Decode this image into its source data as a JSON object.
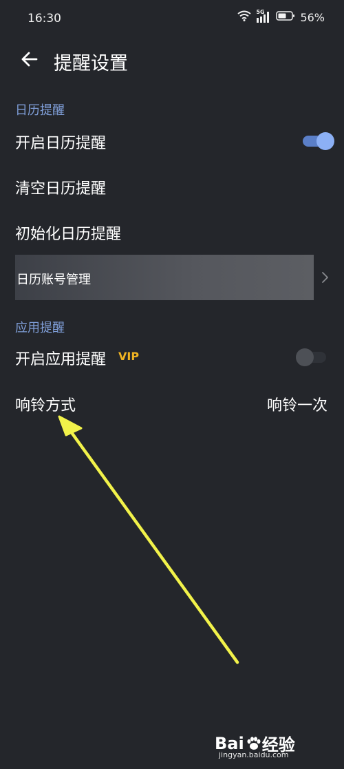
{
  "status_bar": {
    "time": "16:30",
    "network": "5G",
    "battery": "56%"
  },
  "header": {
    "title": "提醒设置"
  },
  "calendar_section": {
    "label": "日历提醒",
    "items": [
      {
        "label": "开启日历提醒",
        "toggle": true
      },
      {
        "label": "清空日历提醒"
      },
      {
        "label": "初始化日历提醒"
      },
      {
        "label": "日历账号管理"
      }
    ]
  },
  "app_section": {
    "label": "应用提醒",
    "enable": {
      "label": "开启应用提醒",
      "badge": "VIP",
      "toggle": false
    },
    "ring": {
      "label": "响铃方式",
      "value": "响铃一次"
    }
  },
  "colors": {
    "background": "#24262b",
    "section_label": "#7f9ed8",
    "toggle_on": "#8cb0f5",
    "vip": "#f0b322",
    "annotation_arrow": "#f2f24a"
  },
  "watermark": {
    "brand_left": "Bai",
    "brand_right": "经验",
    "url": "jingyan.baidu.com"
  }
}
